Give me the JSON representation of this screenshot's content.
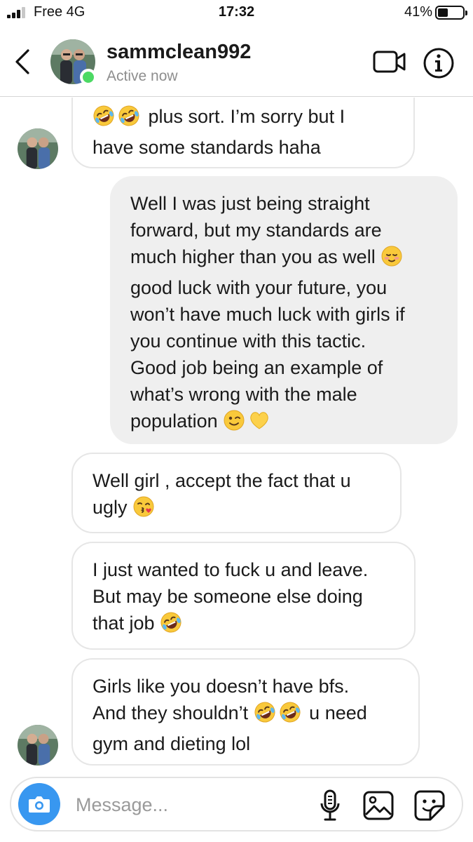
{
  "status_bar": {
    "carrier": "Free 4G",
    "time": "17:32",
    "battery_percent": "41%",
    "battery_level": 0.41
  },
  "header": {
    "back_icon": "chevron-left-icon",
    "username": "sammclean992",
    "status": "Active now",
    "video_icon": "video-camera-icon",
    "info_icon": "info-icon"
  },
  "messages": [
    {
      "direction": "incoming",
      "lines": [
        [
          {
            "t": "e",
            "v": "rofl"
          },
          {
            "t": "e",
            "v": "rofl"
          },
          {
            "t": "s",
            "v": " plus sort. I’m sorry but I"
          }
        ],
        [
          {
            "t": "s",
            "v": "have some standards haha"
          }
        ]
      ]
    },
    {
      "direction": "outgoing",
      "lines": [
        [
          {
            "t": "s",
            "v": "Well I was just being straight"
          }
        ],
        [
          {
            "t": "s",
            "v": "forward, but my standards are"
          }
        ],
        [
          {
            "t": "s",
            "v": "much higher than you as well "
          },
          {
            "t": "e",
            "v": "blush"
          }
        ],
        [
          {
            "t": "s",
            "v": "good luck with your future, you"
          }
        ],
        [
          {
            "t": "s",
            "v": "won’t have much luck with girls if"
          }
        ],
        [
          {
            "t": "s",
            "v": "you continue with this tactic."
          }
        ],
        [
          {
            "t": "s",
            "v": "Good job being an example of"
          }
        ],
        [
          {
            "t": "s",
            "v": "what’s wrong with the male"
          }
        ],
        [
          {
            "t": "s",
            "v": "population "
          },
          {
            "t": "e",
            "v": "wink"
          },
          {
            "t": "e",
            "v": "yellow-heart"
          }
        ]
      ]
    },
    {
      "direction": "incoming",
      "lines": [
        [
          {
            "t": "s",
            "v": "Well girl , accept the fact that u"
          }
        ],
        [
          {
            "t": "s",
            "v": "ugly "
          },
          {
            "t": "e",
            "v": "kiss"
          }
        ]
      ]
    },
    {
      "direction": "incoming",
      "lines": [
        [
          {
            "t": "s",
            "v": "I just wanted to fuck u and leave."
          }
        ],
        [
          {
            "t": "s",
            "v": "But may be someone else doing"
          }
        ],
        [
          {
            "t": "s",
            "v": "that job "
          },
          {
            "t": "e",
            "v": "rofl"
          }
        ]
      ]
    },
    {
      "direction": "incoming",
      "lines": [
        [
          {
            "t": "s",
            "v": "Girls like you doesn’t have bfs."
          }
        ],
        [
          {
            "t": "s",
            "v": "And they shouldn’t "
          },
          {
            "t": "e",
            "v": "rofl"
          },
          {
            "t": "e",
            "v": "rofl"
          },
          {
            "t": "s",
            "v": " u need"
          }
        ],
        [
          {
            "t": "s",
            "v": "gym and dieting lol"
          }
        ]
      ]
    }
  ],
  "composer": {
    "placeholder": "Message...",
    "value": "",
    "camera_icon": "camera-icon",
    "mic_icon": "microphone-icon",
    "gallery_icon": "gallery-icon",
    "sticker_icon": "sticker-icon"
  },
  "colors": {
    "accent": "#3897f0",
    "active_dot": "#4cd964",
    "outgoing_bubble": "#efefef",
    "incoming_border": "#e6e6e6",
    "secondary_text": "#8e8e8e"
  }
}
